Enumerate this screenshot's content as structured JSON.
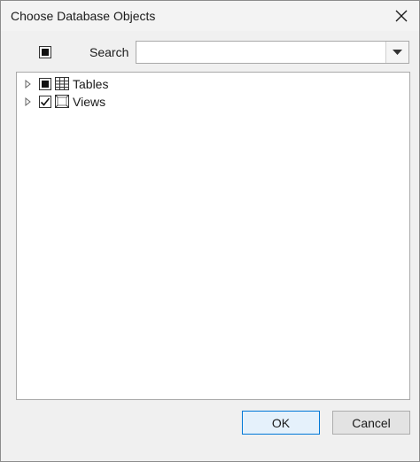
{
  "dialog": {
    "title": "Choose Database Objects",
    "close_icon": "close-icon"
  },
  "filter": {
    "toggle_state": "indeterminate",
    "search_label": "Search",
    "search_value": "",
    "dropdown_icon": "chevron-down-icon"
  },
  "tree": {
    "items": [
      {
        "label": "Tables",
        "check_state": "indeterminate",
        "icon": "table-icon",
        "expander_icon": "expand-arrow-icon"
      },
      {
        "label": "Views",
        "check_state": "checked",
        "icon": "view-icon",
        "expander_icon": "expand-arrow-icon"
      }
    ]
  },
  "buttons": {
    "ok_label": "OK",
    "cancel_label": "Cancel"
  },
  "colors": {
    "accent": "#0078d7",
    "background": "#f0f0f0"
  }
}
